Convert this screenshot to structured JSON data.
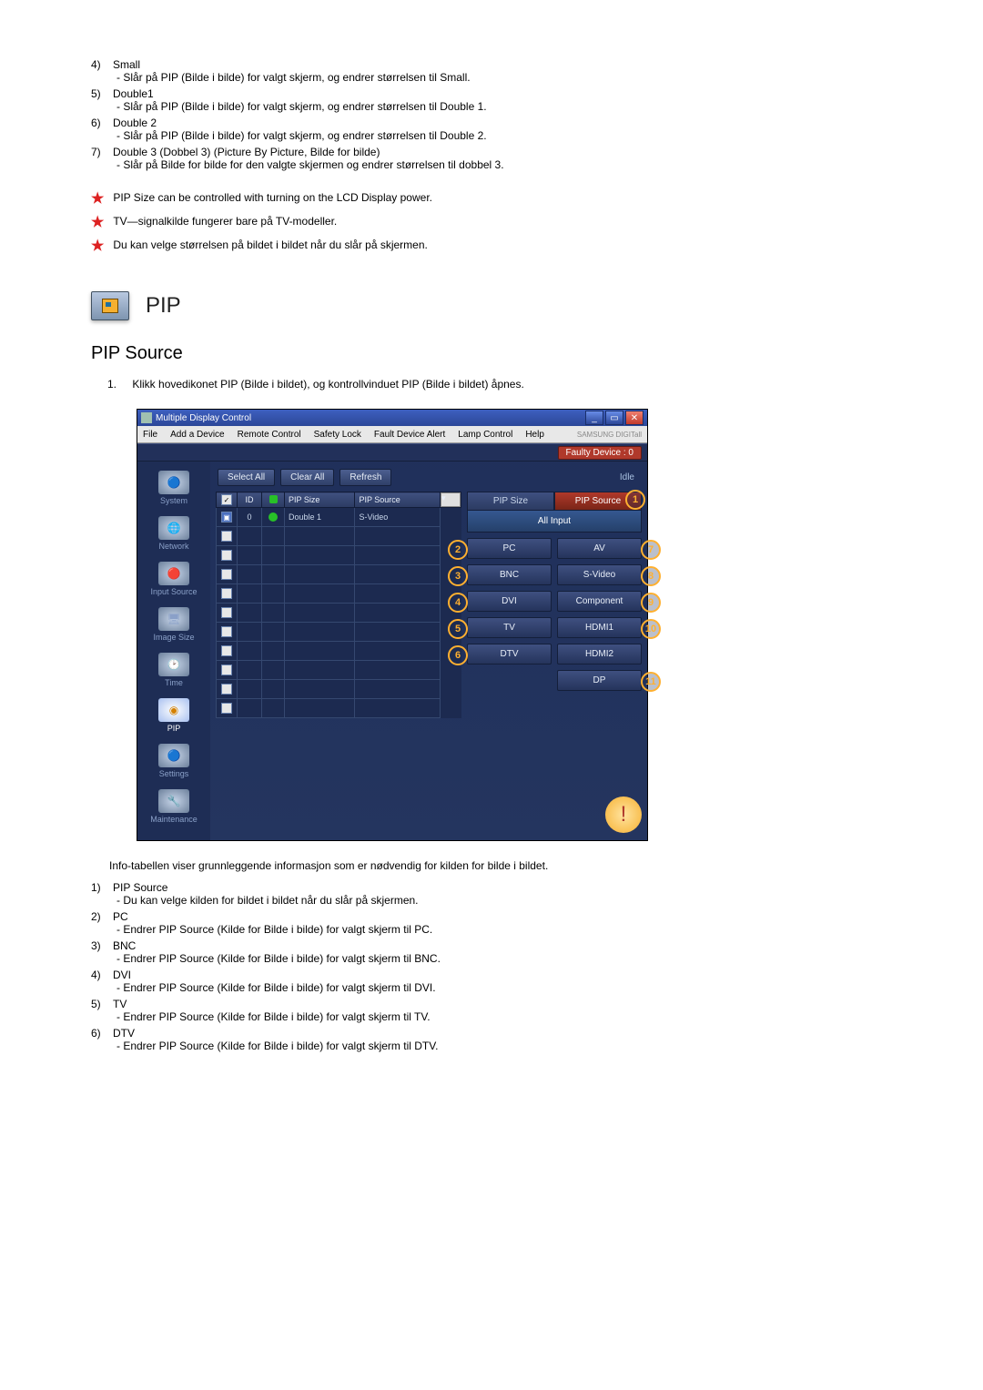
{
  "top_list": [
    {
      "num": "4)",
      "title": "Small",
      "sub": "- Slår på PIP (Bilde i bilde) for valgt skjerm, og endrer størrelsen til Small."
    },
    {
      "num": "5)",
      "title": "Double1",
      "sub": "- Slår på PIP (Bilde i bilde) for valgt skjerm, og endrer størrelsen til Double 1."
    },
    {
      "num": "6)",
      "title": "Double 2",
      "sub": "- Slår på PIP (Bilde i bilde) for valgt skjerm, og endrer størrelsen til Double 2."
    },
    {
      "num": "7)",
      "title": "Double 3 (Dobbel 3) (Picture By Picture, Bilde for bilde)",
      "sub": "- Slår på Bilde for bilde for den valgte skjermen og endrer størrelsen til dobbel 3."
    }
  ],
  "star_notes": [
    "PIP Size can be controlled with turning on the LCD Display power.",
    "TV—signalkilde fungerer bare på TV-modeller.",
    "Du kan velge størrelsen på bildet i bildet når du slår på skjermen."
  ],
  "pip_label": "PIP",
  "section_title": "PIP Source",
  "intro": {
    "num": "1.",
    "text": "Klikk hovedikonet PIP (Bilde i bildet), og kontrollvinduet PIP (Bilde i bildet) åpnes."
  },
  "app": {
    "title": "Multiple Display Control",
    "menu": [
      "File",
      "Add a Device",
      "Remote Control",
      "Safety Lock",
      "Fault Device Alert",
      "Lamp Control",
      "Help"
    ],
    "brand": "SAMSUNG DIGITall",
    "faulty": "Faulty Device : 0",
    "buttons": {
      "select_all": "Select All",
      "clear_all": "Clear All",
      "refresh": "Refresh"
    },
    "idle": "Idle",
    "table": {
      "headers": {
        "id": "ID",
        "pip_size": "PIP Size",
        "pip_source": "PIP Source"
      },
      "row": {
        "id": "0",
        "pip_size": "Double 1",
        "pip_source": "S-Video",
        "status_color": "#28c028"
      },
      "empty_rows": 10
    },
    "sidebar": [
      {
        "label": "System",
        "cls": "system"
      },
      {
        "label": "Network",
        "cls": "network"
      },
      {
        "label": "Input Source",
        "cls": "input"
      },
      {
        "label": "Image Size",
        "cls": "image"
      },
      {
        "label": "Time",
        "cls": "time"
      },
      {
        "label": "PIP",
        "cls": "pip"
      },
      {
        "label": "Settings",
        "cls": "settings"
      },
      {
        "label": "Maintenance",
        "cls": "maint"
      }
    ],
    "tabs": {
      "left": "PIP Size",
      "right": "PIP Source"
    },
    "all_input": "All Input",
    "left_sources": [
      {
        "label": "PC",
        "callout": "2"
      },
      {
        "label": "BNC",
        "callout": "3"
      },
      {
        "label": "DVI",
        "callout": "4"
      },
      {
        "label": "TV",
        "callout": "5"
      },
      {
        "label": "DTV",
        "callout": "6"
      }
    ],
    "right_sources": [
      {
        "label": "AV",
        "callout": "7"
      },
      {
        "label": "S-Video",
        "callout": "8"
      },
      {
        "label": "Component",
        "callout": "9"
      },
      {
        "label": "HDMI1",
        "callout": "10"
      },
      {
        "label": "HDMI2",
        "callout": ""
      },
      {
        "label": "DP",
        "callout": "11"
      }
    ],
    "tab_callout": "1"
  },
  "below": "Info-tabellen viser grunnleggende informasjon som er nødvendig for kilden for bilde i bildet.",
  "bottom_list": [
    {
      "num": "1)",
      "title": "PIP Source",
      "sub": "- Du kan velge kilden for bildet i bildet når du slår på skjermen."
    },
    {
      "num": "2)",
      "title": "PC",
      "sub": "- Endrer PIP Source (Kilde for Bilde i bilde) for valgt skjerm til PC."
    },
    {
      "num": "3)",
      "title": "BNC",
      "sub": "- Endrer PIP Source (Kilde for Bilde i bilde) for valgt skjerm til BNC."
    },
    {
      "num": "4)",
      "title": "DVI",
      "sub": "- Endrer PIP Source (Kilde for Bilde i bilde) for valgt skjerm til DVI."
    },
    {
      "num": "5)",
      "title": "TV",
      "sub": "- Endrer PIP Source (Kilde for Bilde i bilde) for valgt skjerm til TV."
    },
    {
      "num": "6)",
      "title": "DTV",
      "sub": "- Endrer PIP Source (Kilde for Bilde i bilde) for valgt skjerm til DTV."
    }
  ]
}
